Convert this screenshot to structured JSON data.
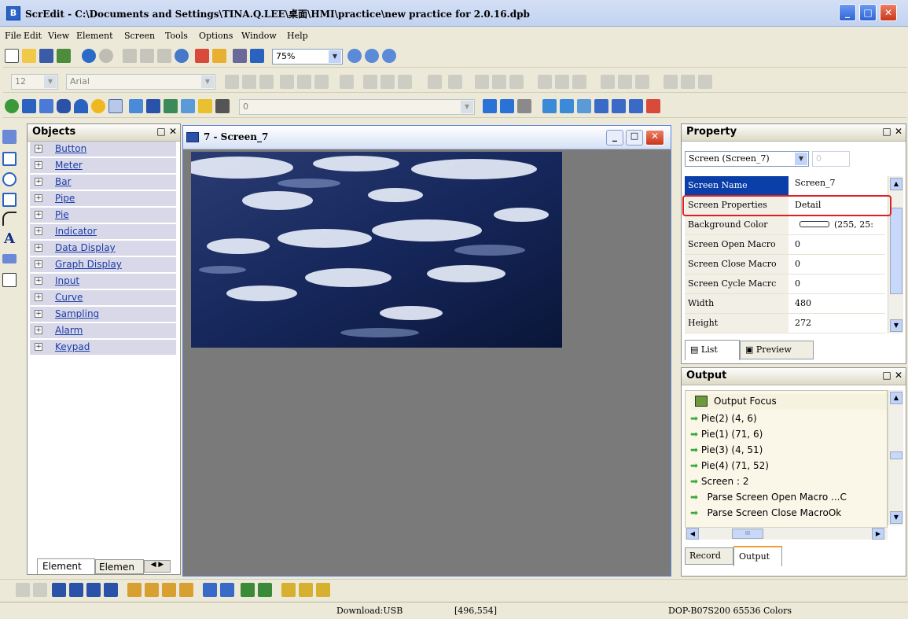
{
  "window": {
    "title": "ScrEdit - C:\\Documents and Settings\\TINA.Q.LEE\\桌面\\HMI\\practice\\new practice for 2.0.16.dpb",
    "app_icon": "B",
    "minimize": "_",
    "maximize": "□",
    "close": "✕"
  },
  "menu": [
    "File",
    "Edit",
    "View",
    "Element",
    "Screen",
    "Tools",
    "Options",
    "Window",
    "Help"
  ],
  "toolbar": {
    "zoom_value": "75%",
    "font_size": "12",
    "font_name": "Arial",
    "element_combo": "0"
  },
  "objects_panel": {
    "title": "Objects",
    "items": [
      "Button",
      "Meter",
      "Bar",
      "Pipe",
      "Pie",
      "Indicator",
      "Data Display",
      "Graph Display",
      "Input",
      "Curve",
      "Sampling",
      "Alarm",
      "Keypad"
    ],
    "tabs": [
      "Element",
      "Elemen"
    ]
  },
  "screen_window": {
    "title": "7 - Screen_7"
  },
  "property_panel": {
    "title": "Property",
    "selector": "Screen (Screen_7)",
    "selector_index": "0",
    "rows": [
      {
        "key": "Screen Name",
        "value": "Screen_7"
      },
      {
        "key": "Screen Properties",
        "value": "Detail"
      },
      {
        "key": "Background Color",
        "value": "(255, 25:"
      },
      {
        "key": "Screen Open Macro",
        "value": "0"
      },
      {
        "key": "Screen Close Macro",
        "value": "0"
      },
      {
        "key": "Screen Cycle Macrc",
        "value": "0"
      },
      {
        "key": "Width",
        "value": "480"
      },
      {
        "key": "Height",
        "value": "272"
      }
    ],
    "tabs": [
      "List",
      "Preview"
    ],
    "highlight_color": "#e02020"
  },
  "output_panel": {
    "title": "Output",
    "focus_label": "Output Focus",
    "lines": [
      "Pie(2) (4, 6)",
      "Pie(1) (71, 6)",
      "Pie(3) (4, 51)",
      "Pie(4) (71, 52)",
      "Screen : 2",
      "  Parse Screen Open Macro ...C",
      "  Parse Screen Close MacroOk"
    ],
    "tabs": [
      "Record",
      "Output"
    ],
    "scroll_mark": "III"
  },
  "status": {
    "download": "Download:USB",
    "coords": "[496,554]",
    "device": "DOP-B07S200 65536 Colors"
  },
  "icons": {
    "accent": "#2f63d6",
    "toolbar_bg": "#ece9d8"
  }
}
